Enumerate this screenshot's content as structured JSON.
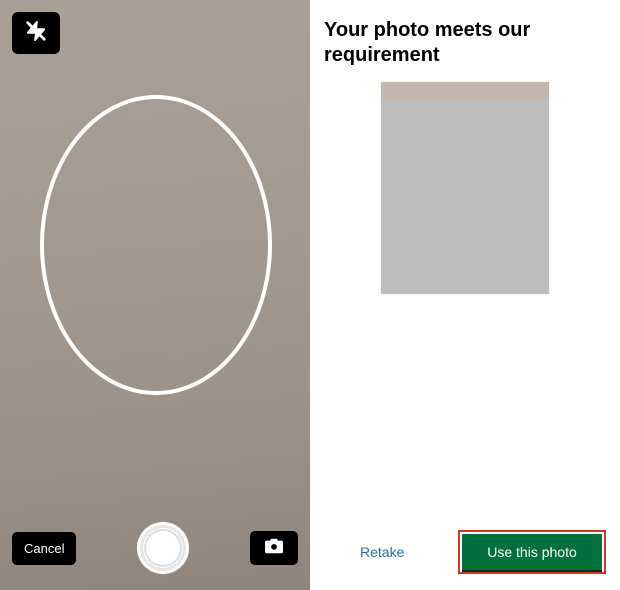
{
  "left": {
    "cancel_label": "Cancel"
  },
  "right": {
    "heading": "Your photo meets our requirement",
    "retake_label": "Retake",
    "use_photo_label": "Use this photo"
  },
  "colors": {
    "primary_button": "#00703c",
    "link": "#1d70b8",
    "highlight_border": "#d4351c"
  }
}
